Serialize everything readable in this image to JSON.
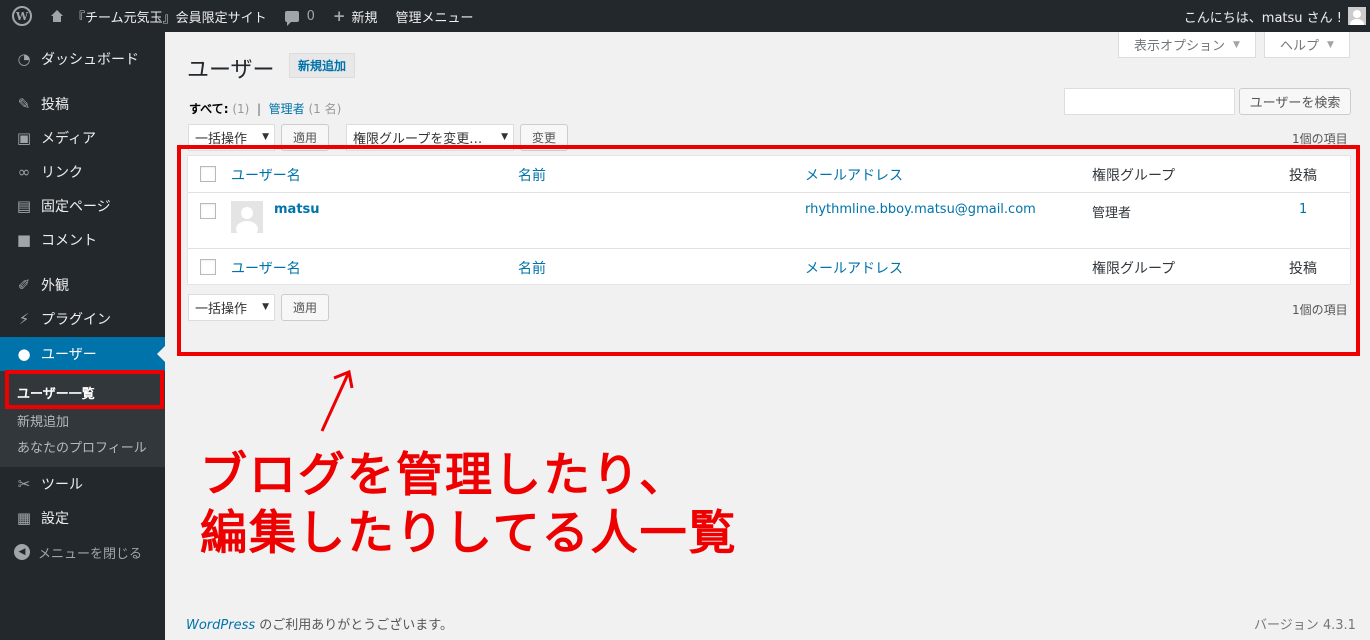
{
  "adminbar": {
    "wp_icon": "wordpress-logo-icon",
    "site_name": "『チーム元気玉』会員限定サイト",
    "comments_count": "0",
    "new_label": "新規",
    "admin_menu_label": "管理メニュー",
    "greeting": "こんにちは、matsu さん !"
  },
  "sidebar": {
    "items": [
      {
        "label": "ダッシュボード",
        "icon": "dashboard-icon"
      },
      {
        "label": "投稿",
        "icon": "pin-icon"
      },
      {
        "label": "メディア",
        "icon": "media-icon"
      },
      {
        "label": "リンク",
        "icon": "link-icon"
      },
      {
        "label": "固定ページ",
        "icon": "pages-icon"
      },
      {
        "label": "コメント",
        "icon": "comment-icon"
      },
      {
        "label": "外観",
        "icon": "brush-icon"
      },
      {
        "label": "プラグイン",
        "icon": "plugin-icon"
      },
      {
        "label": "ユーザー",
        "icon": "user-icon"
      },
      {
        "label": "ツール",
        "icon": "wrench-icon"
      },
      {
        "label": "設定",
        "icon": "settings-icon"
      }
    ],
    "submenu": [
      "ユーザー一覧",
      "新規追加",
      "あなたのプロフィール"
    ],
    "collapse_label": "メニューを閉じる"
  },
  "header": {
    "screen_options": "表示オプション",
    "help": "ヘルプ",
    "title": "ユーザー",
    "add_new": "新規追加"
  },
  "filters": {
    "all_label": "すべて",
    "all_count": "(1)",
    "separator": "|",
    "admin_label": "管理者",
    "admin_count": "(1 名)"
  },
  "search": {
    "value": "",
    "button": "ユーザーを検索"
  },
  "tablenav": {
    "bulk_action": "一括操作",
    "apply": "適用",
    "role_change": "権限グループを変更…",
    "change": "変更",
    "items_count": "1個の項目"
  },
  "table": {
    "columns": [
      "ユーザー名",
      "名前",
      "メールアドレス",
      "権限グループ",
      "投稿"
    ],
    "rows": [
      {
        "username": "matsu",
        "name": "",
        "email": "rhythmline.bboy.matsu@gmail.com",
        "role": "管理者",
        "posts": "1"
      }
    ]
  },
  "footer": {
    "wp_link": "WordPress",
    "thanks": " のご利用ありがとうございます。",
    "version": "バージョン 4.3.1"
  },
  "annotation": {
    "line1": "ブログを管理したり、",
    "line2": "編集したりしてる人一覧",
    "color": "#e00000"
  }
}
